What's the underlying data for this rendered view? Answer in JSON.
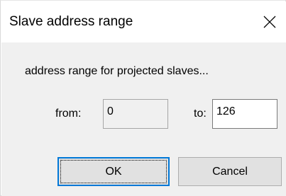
{
  "dialog": {
    "title": "Slave address range",
    "prompt": "address range for projected slaves...",
    "from_label": "from:",
    "from_value": "0",
    "to_label": "to:",
    "to_value": "126",
    "ok_label": "OK",
    "cancel_label": "Cancel"
  },
  "icons": {
    "close": "close-icon"
  },
  "colors": {
    "client_background": "#f0f0f0",
    "focus_border": "#0078d7",
    "button_face": "#e1e1e1"
  }
}
